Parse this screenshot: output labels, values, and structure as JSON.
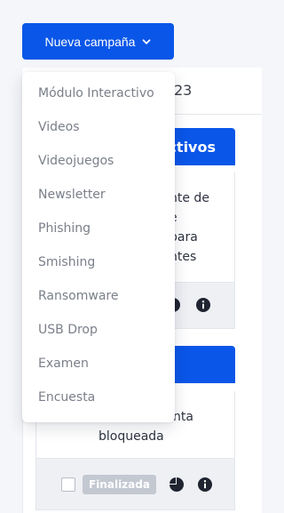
{
  "header": {
    "new_campaign_label": "Nueva campaña"
  },
  "background": {
    "year_fragment": "23"
  },
  "cards": [
    {
      "header_fragment": "ctivos",
      "description_lines": [
        "nte de",
        "e",
        "para",
        "ntes"
      ]
    },
    {
      "header_fragment": "",
      "description_lines": [
        "nta",
        "bloqueada"
      ],
      "status_badge": "Finalizada"
    }
  ],
  "dropdown": {
    "items": [
      "Módulo Interactivo",
      "Videos",
      "Videojuegos",
      "Newsletter",
      "Phishing",
      "Smishing",
      "Ransomware",
      "USB Drop",
      "Examen",
      "Encuesta"
    ]
  },
  "colors": {
    "primary": "#0a56e8",
    "badge_grey": "#c3c8d1",
    "menu_text": "#7a7f89"
  },
  "icons": {
    "chevron": "chevron-down-icon",
    "pie": "pie-chart-icon",
    "info": "info-icon"
  }
}
